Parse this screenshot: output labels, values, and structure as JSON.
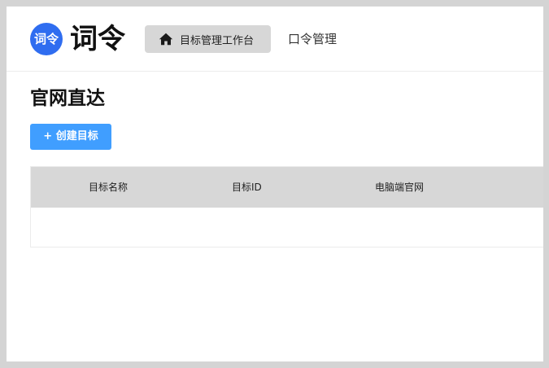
{
  "brand": {
    "badge_text": "词令",
    "name": "词令",
    "badge_color": "#2f6df0"
  },
  "nav": {
    "items": [
      {
        "label": "目标管理工作台",
        "icon": "home-icon",
        "active": true
      },
      {
        "label": "口令管理",
        "active": false
      }
    ]
  },
  "page": {
    "title": "官网直达"
  },
  "actions": {
    "create_label": "+ 创建目标",
    "create_color": "#409eff"
  },
  "table": {
    "columns": [
      "目标名称",
      "目标ID",
      "电脑端官网"
    ],
    "rows": []
  }
}
